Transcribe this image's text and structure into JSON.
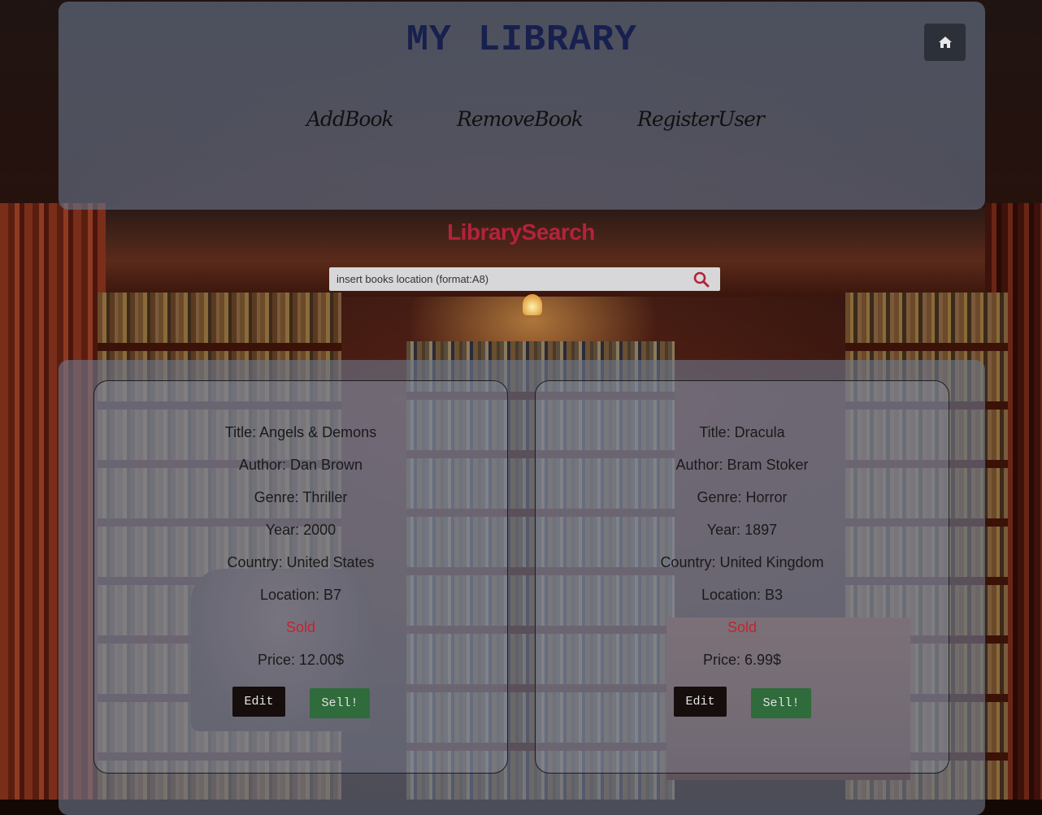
{
  "header": {
    "title": "MY LIBRARY",
    "home_icon": "home-icon",
    "nav": [
      {
        "label": "AddBook"
      },
      {
        "label": "RemoveBook"
      },
      {
        "label": "RegisterUser"
      }
    ]
  },
  "search": {
    "title_part1": "Library",
    "title_part2": "Search",
    "placeholder": "insert books location (format:A8)",
    "value": "",
    "icon": "search-icon",
    "accent_color": "#b3233a"
  },
  "books": [
    {
      "title": "Title: Angels & Demons",
      "author": "Author: Dan Brown",
      "genre": "Genre: Thriller",
      "year": "Year: 2000",
      "country": "Country: United States",
      "location": "Location: B7",
      "status": "Sold",
      "price": "Price: 12.00$",
      "edit_label": "Edit",
      "sell_label": "Sell!"
    },
    {
      "title": "Title: Dracula",
      "author": "Author: Bram Stoker",
      "genre": "Genre: Horror",
      "year": "Year: 1897",
      "country": "Country: United Kingdom",
      "location": "Location: B3",
      "status": "Sold",
      "price": "Price: 6.99$",
      "edit_label": "Edit",
      "sell_label": "Sell!"
    }
  ]
}
